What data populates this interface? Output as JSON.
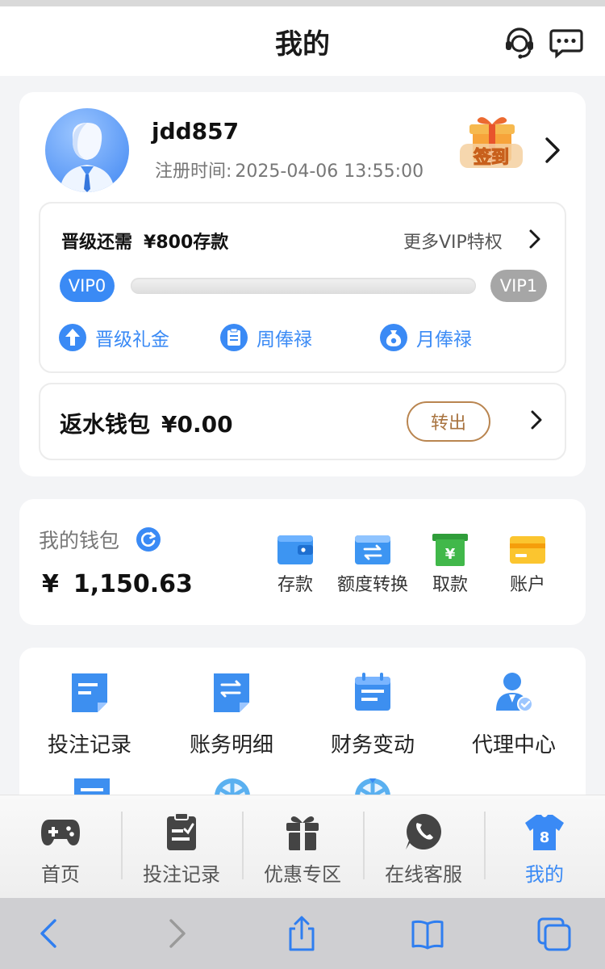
{
  "header": {
    "title": "我的",
    "icons": [
      "customer-service-icon",
      "message-icon"
    ]
  },
  "profile": {
    "username": "jdd857",
    "reg_label": "注册时间:",
    "reg_time": "2025-04-06 13:55:00",
    "signin_label": "签到"
  },
  "vip": {
    "need_label": "晋级还需",
    "need_amount": "¥800存款",
    "more_label": "更多VIP特权",
    "current_level": "VIP0",
    "next_level": "VIP1",
    "progress": 0,
    "perks": [
      "晋级礼金",
      "周俸禄",
      "月俸禄"
    ]
  },
  "rebate": {
    "label": "返水钱包",
    "amount": "¥0.00",
    "button": "转出"
  },
  "wallet": {
    "title": "我的钱包",
    "currency": "¥",
    "balance": "1,150.63",
    "actions": [
      "存款",
      "额度转换",
      "取款",
      "账户"
    ]
  },
  "menu": {
    "items": [
      "投注记录",
      "账务明细",
      "财务变动",
      "代理中心"
    ]
  },
  "tabbar": {
    "items": [
      "首页",
      "投注记录",
      "优惠专区",
      "在线客服",
      "我的"
    ],
    "active": "我的",
    "active_color": "#3a8af5"
  },
  "colors": {
    "accent": "#3a8af5",
    "transfer_border": "#b98550"
  }
}
